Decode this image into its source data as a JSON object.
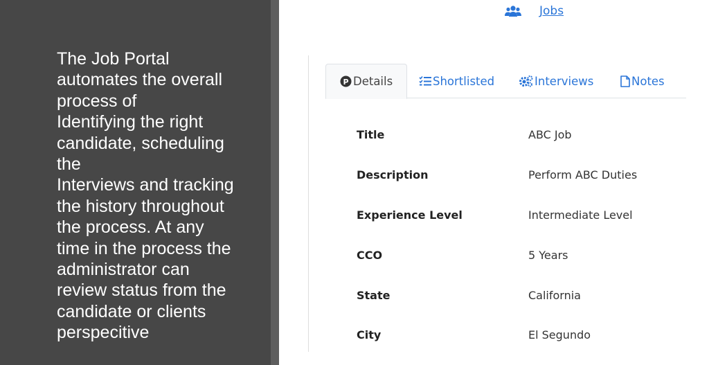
{
  "intro": {
    "lines": [
      "The Job Portal",
      "automates the overall",
      "process of",
      "Identifying the right",
      "candidate, scheduling",
      "the",
      "Interviews and tracking",
      "the history throughout",
      "the process. At any",
      "time in the process the",
      "administrator can",
      "review status from the",
      "candidate or clients",
      "perspecitive"
    ]
  },
  "header": {
    "jobs_link": "Jobs",
    "jobs_icon": "users-icon"
  },
  "tabs": [
    {
      "label": "Details",
      "icon": "p-circle-icon",
      "active": true
    },
    {
      "label": "Shortlisted",
      "icon": "list-check-icon",
      "active": false
    },
    {
      "label": "Interviews",
      "icon": "cogs-icon",
      "active": false
    },
    {
      "label": "Notes",
      "icon": "file-icon",
      "active": false
    }
  ],
  "details": [
    {
      "label": "Title",
      "value": "ABC Job"
    },
    {
      "label": "Description",
      "value": "Perform ABC Duties"
    },
    {
      "label": "Experience Level",
      "value": "Intermediate Level"
    },
    {
      "label": "CCO",
      "value": "5 Years"
    },
    {
      "label": "State",
      "value": "California"
    },
    {
      "label": "City",
      "value": "El Segundo"
    }
  ],
  "colors": {
    "panel_bg": "#474747",
    "link": "#2a75d8",
    "text": "#333333"
  }
}
